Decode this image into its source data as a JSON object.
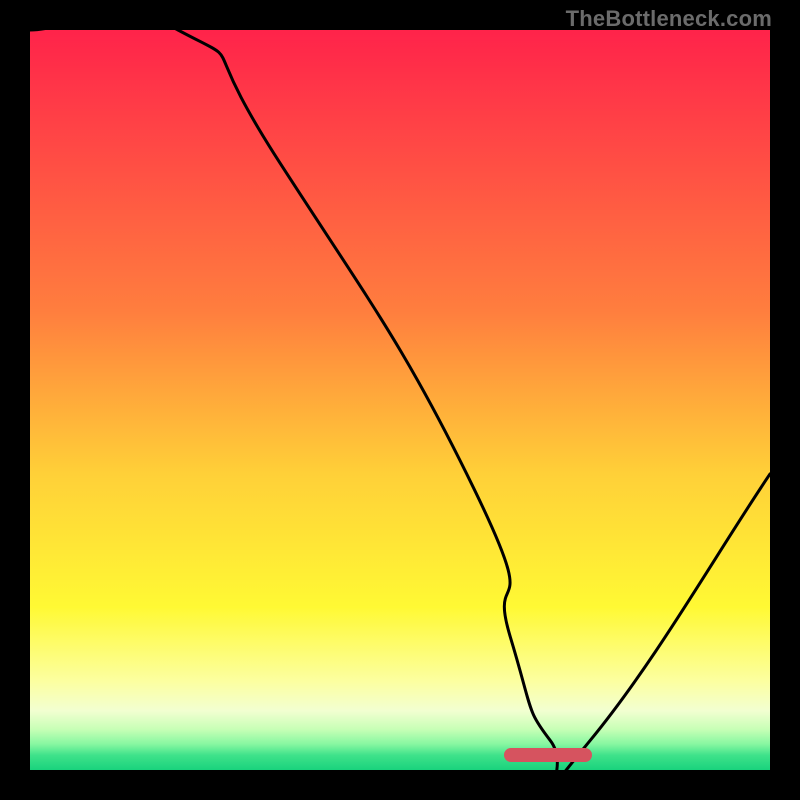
{
  "watermark": {
    "text": "TheBottleneck.com"
  },
  "chart_data": {
    "type": "area",
    "title": "",
    "xlabel": "",
    "ylabel": "",
    "xlim": [
      0,
      100
    ],
    "ylim": [
      0,
      100
    ],
    "series": [
      {
        "name": "bottleneck-curve",
        "x": [
          0,
          20,
          33.8,
          60,
          64.9,
          70.3,
          75.7,
          100
        ],
        "values": [
          100,
          100,
          82,
          38,
          18,
          4,
          4,
          40
        ],
        "color": "#000000"
      }
    ],
    "marker": {
      "name": "optimal-range",
      "x_start": 64,
      "x_end": 76,
      "y": 2,
      "color": "#d6535f",
      "shape": "pill"
    },
    "background_gradient": {
      "type": "vertical",
      "stops": [
        {
          "offset": 0,
          "color": "#ff234a"
        },
        {
          "offset": 38,
          "color": "#ff7e3e"
        },
        {
          "offset": 60,
          "color": "#ffd038"
        },
        {
          "offset": 78,
          "color": "#fff934"
        },
        {
          "offset": 88,
          "color": "#fcffa0"
        },
        {
          "offset": 92,
          "color": "#f2ffd1"
        },
        {
          "offset": 94.5,
          "color": "#c7ffb6"
        },
        {
          "offset": 96.5,
          "color": "#87f7a1"
        },
        {
          "offset": 98,
          "color": "#3fe28a"
        },
        {
          "offset": 100,
          "color": "#19d37d"
        }
      ]
    },
    "annotations": []
  }
}
